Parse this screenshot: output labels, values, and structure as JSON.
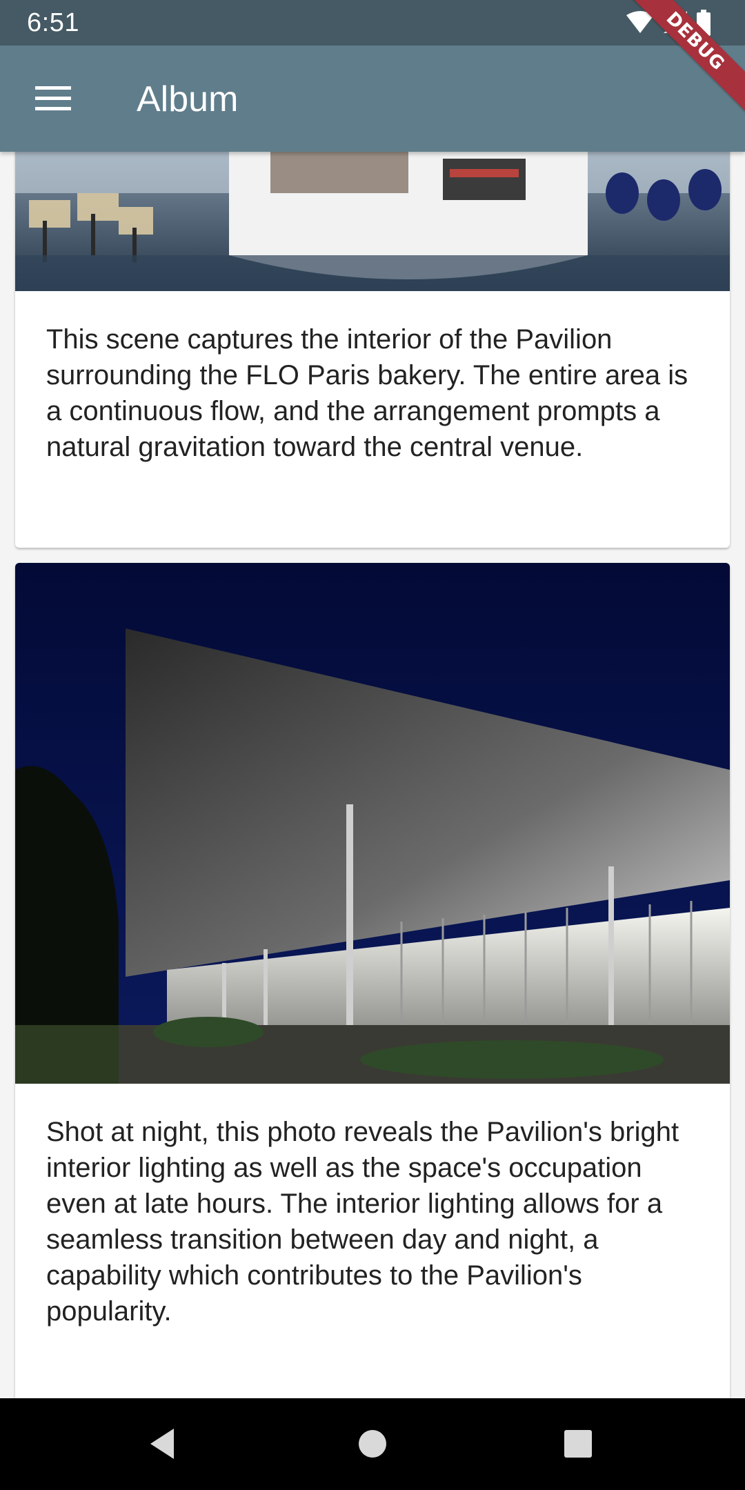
{
  "status_bar": {
    "time": "6:51",
    "icons": [
      "wifi-icon",
      "signal-icon",
      "battery-icon"
    ]
  },
  "app_bar": {
    "title": "Album",
    "menu_icon": "menu-icon",
    "background": "#607d8b"
  },
  "debug_banner": {
    "label": "DEBUG"
  },
  "cards": [
    {
      "image_alt": "Interior of the Pavilion with the FLO Paris bakery counter",
      "description": "This scene captures the interior of the Pavilion surrounding the FLO Paris bakery. The entire area is a continuous flow, and the arrangement prompts a natural gravitation toward the central venue."
    },
    {
      "image_alt": "The Pavilion at night with bright interior lighting",
      "description": "Shot at night, this photo reveals the Pavilion's bright interior lighting as well as the space's occupation even at late hours. The interior lighting allows for a seamless transition between day and night, a capability which contributes to the Pavilion's popularity."
    }
  ],
  "nav_bar": {
    "back_icon": "back-triangle-icon",
    "home_icon": "home-circle-icon",
    "recents_icon": "recents-square-icon"
  }
}
